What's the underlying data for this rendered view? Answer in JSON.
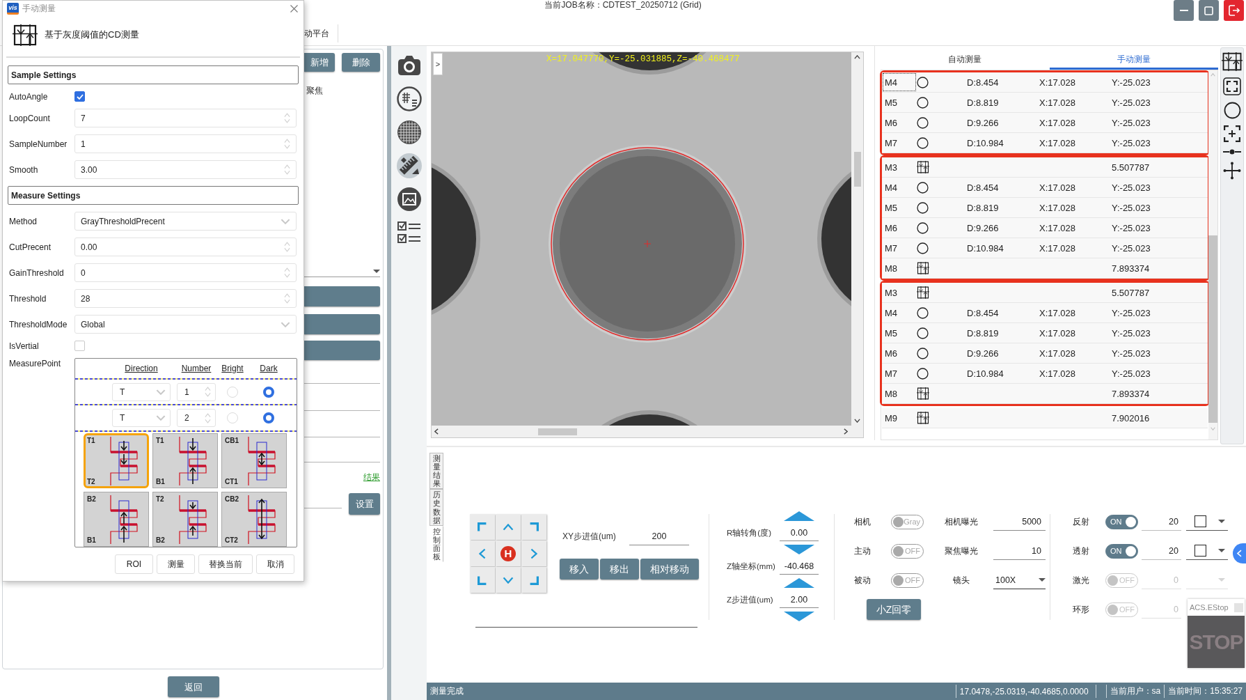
{
  "title_bar": {
    "title": "当前JOB名称：CDTEST_20250712 (Grid)",
    "window_buttons": [
      {
        "kind": "minimize"
      },
      {
        "kind": "maximize"
      },
      {
        "kind": "exit"
      }
    ]
  },
  "menu": {
    "items": [
      "动平台"
    ]
  },
  "side_panel": {
    "buttons": [
      "新增",
      "删除"
    ],
    "option_text": "聚焦",
    "link": "结果",
    "settings_button": "设置",
    "back_button": "返回"
  },
  "dialog": {
    "logo": "vis",
    "title": "手动测量",
    "heading": "基于灰度阈值的CD测量",
    "sections": [
      {
        "title": "Sample Settings",
        "fields": [
          {
            "label": "AutoAngle",
            "kind": "checkbox",
            "checked": true
          },
          {
            "label": "LoopCount",
            "kind": "spin",
            "value": "7"
          },
          {
            "label": "SampleNumber",
            "kind": "spin",
            "value": "1"
          },
          {
            "label": "Smooth",
            "kind": "spin",
            "value": "3.00"
          }
        ]
      },
      {
        "title": "Measure Settings",
        "fields": [
          {
            "label": "Method",
            "kind": "select",
            "value": "GrayThresholdPrecent"
          },
          {
            "label": "CutPrecent",
            "kind": "spin",
            "value": "0.00"
          },
          {
            "label": "GainThreshold",
            "kind": "spin",
            "value": "0"
          },
          {
            "label": "Threshold",
            "kind": "spin",
            "value": "28"
          },
          {
            "label": "ThresholdMode",
            "kind": "select",
            "value": "Global"
          },
          {
            "label": "IsVertial",
            "kind": "checkbox",
            "checked": false
          }
        ]
      }
    ],
    "measure_point": {
      "label": "MeasurePoint",
      "columns": [
        "Direction",
        "Number",
        "Bright",
        "Dark"
      ],
      "rows": [
        {
          "direction": "T",
          "number": "1",
          "options": [
            {
              "selected": false
            },
            {
              "selected": true
            }
          ]
        },
        {
          "direction": "T",
          "number": "2",
          "options": [
            {
              "selected": false
            },
            {
              "selected": true
            }
          ]
        }
      ],
      "modes": [
        {
          "kind": "down",
          "top": "T1",
          "bottom": "T2",
          "selected": true
        },
        {
          "kind": "split",
          "top": "T1",
          "bottom": "B1",
          "selected": false
        },
        {
          "kind": "inner",
          "top": "CB1",
          "bottom": "CT1",
          "selected": false
        },
        {
          "kind": "up",
          "top": "B2",
          "bottom": "B1",
          "selected": false
        },
        {
          "kind": "meet",
          "top": "T2",
          "bottom": "B2",
          "selected": false
        },
        {
          "kind": "outer",
          "top": "CB2",
          "bottom": "CT2",
          "selected": false
        }
      ]
    },
    "buttons": [
      "ROI",
      "测量",
      "替换当前",
      "取消"
    ]
  },
  "toolbar": {
    "tools": [
      {
        "kind": "camera",
        "selected": false
      },
      {
        "kind": "gridlist",
        "selected": false
      },
      {
        "kind": "gridball",
        "selected": false
      },
      {
        "kind": "ruler",
        "selected": true
      },
      {
        "kind": "frame",
        "selected": false
      },
      {
        "kind": "checklist",
        "selected": false
      }
    ]
  },
  "image_view": {
    "expand_button": ">",
    "overlay": "X=17.047770,Y=-25.031885,Z=-40.468477"
  },
  "results": {
    "tabs": [
      {
        "label": "自动测量",
        "selected": false
      },
      {
        "label": "手动测量",
        "selected": true
      }
    ],
    "groups": [
      {
        "highlighted": true,
        "rows": [
          {
            "name": "M4",
            "kind": "circle",
            "diameter": "D:8.454",
            "x": "X:17.028",
            "y": "Y:-25.023",
            "selected": true
          },
          {
            "name": "M5",
            "kind": "circle",
            "diameter": "D:8.819",
            "x": "X:17.028",
            "y": "Y:-25.023",
            "selected": false
          },
          {
            "name": "M6",
            "kind": "circle",
            "diameter": "D:9.266",
            "x": "X:17.028",
            "y": "Y:-25.023",
            "selected": false
          },
          {
            "name": "M7",
            "kind": "circle",
            "diameter": "D:10.984",
            "x": "X:17.028",
            "y": "Y:-25.023",
            "selected": false
          }
        ]
      },
      {
        "highlighted": true,
        "rows": [
          {
            "name": "M3",
            "kind": "cd",
            "value": "5.507787",
            "selected": false
          },
          {
            "name": "M4",
            "kind": "circle",
            "diameter": "D:8.454",
            "x": "X:17.028",
            "y": "Y:-25.023",
            "selected": false
          },
          {
            "name": "M5",
            "kind": "circle",
            "diameter": "D:8.819",
            "x": "X:17.028",
            "y": "Y:-25.023",
            "selected": false
          },
          {
            "name": "M6",
            "kind": "circle",
            "diameter": "D:9.266",
            "x": "X:17.028",
            "y": "Y:-25.023",
            "selected": false
          },
          {
            "name": "M7",
            "kind": "circle",
            "diameter": "D:10.984",
            "x": "X:17.028",
            "y": "Y:-25.023",
            "selected": false
          },
          {
            "name": "M8",
            "kind": "cd",
            "value": "7.893374",
            "selected": false
          }
        ]
      },
      {
        "highlighted": true,
        "rows": [
          {
            "name": "M3",
            "kind": "cd",
            "value": "5.507787",
            "selected": false
          },
          {
            "name": "M4",
            "kind": "circle",
            "diameter": "D:8.454",
            "x": "X:17.028",
            "y": "Y:-25.023",
            "selected": false
          },
          {
            "name": "M5",
            "kind": "circle",
            "diameter": "D:8.819",
            "x": "X:17.028",
            "y": "Y:-25.023",
            "selected": false
          },
          {
            "name": "M6",
            "kind": "circle",
            "diameter": "D:9.266",
            "x": "X:17.028",
            "y": "Y:-25.023",
            "selected": false
          },
          {
            "name": "M7",
            "kind": "circle",
            "diameter": "D:10.984",
            "x": "X:17.028",
            "y": "Y:-25.023",
            "selected": false
          },
          {
            "name": "M8",
            "kind": "cd",
            "value": "7.893374",
            "selected": false
          }
        ]
      },
      {
        "highlighted": false,
        "rows": [
          {
            "name": "M9",
            "kind": "cd",
            "value": "7.902016",
            "selected": false
          }
        ]
      }
    ]
  },
  "controls": {
    "side_tabs": [
      {
        "label": "测量结果",
        "selected": false
      },
      {
        "label": "历史数据",
        "selected": false
      },
      {
        "label": "控制面板",
        "selected": true
      }
    ],
    "home_button": "H",
    "xy_step": {
      "label": "XY步进值(um)",
      "value": "200"
    },
    "move_buttons": [
      "移入",
      "移出",
      "相对移动"
    ],
    "axes": [
      {
        "label": "R轴转角(度)",
        "value": "0.00",
        "kind": "stepper"
      },
      {
        "label": "Z轴坐标(mm)",
        "value": "-40.468",
        "kind": "readout"
      },
      {
        "label": "Z步进值(um)",
        "value": "2.00",
        "kind": "stepper"
      }
    ],
    "camera_rows": [
      {
        "label": "相机",
        "toggle_text": "Gray",
        "on": false,
        "setting": "相机曝光",
        "value": "5000",
        "kind": "field"
      },
      {
        "label": "主动",
        "toggle_text": "OFF",
        "on": false,
        "setting": "聚焦曝光",
        "value": "10",
        "kind": "field"
      },
      {
        "label": "被动",
        "toggle_text": "OFF",
        "on": false,
        "setting": "镜头",
        "value": "100X",
        "kind": "select"
      }
    ],
    "zero_button": "小Z回零",
    "lights": [
      {
        "label": "反射",
        "toggle_text": "ON",
        "on": true,
        "value": "20",
        "disabled": false,
        "dropdown": {
          "swatch": true
        }
      },
      {
        "label": "透射",
        "toggle_text": "ON",
        "on": true,
        "value": "20",
        "disabled": false,
        "dropdown": {
          "swatch": true
        }
      },
      {
        "label": "激光",
        "toggle_text": "OFF",
        "on": false,
        "value": "0",
        "disabled": true,
        "dropdown": {
          "swatch": false
        }
      },
      {
        "label": "环形",
        "toggle_text": "OFF",
        "on": false,
        "value": "0",
        "disabled": true
      }
    ],
    "estop": {
      "title": "ACS.EStop",
      "sign": "STOP"
    }
  },
  "status_bar": {
    "message": "测量完成",
    "coordinates": "17.0478,-25.0319,-40.4685,0.0000",
    "user": "当前用户：sa",
    "time": "当前时间：15:35:27"
  }
}
